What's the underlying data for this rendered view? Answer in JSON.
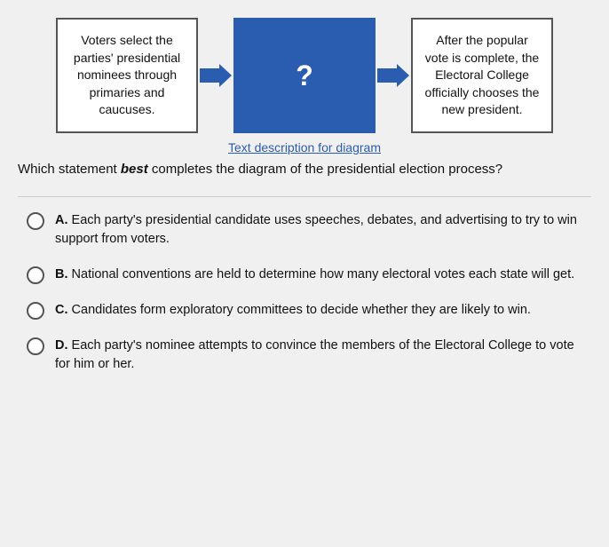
{
  "diagram": {
    "box1_text": "Voters select the parties' presidential nominees through primaries and caucuses.",
    "box2_text": "?",
    "box3_text": "After the popular vote is complete, the Electoral College officially chooses the new president.",
    "caption": "Text description for diagram"
  },
  "question": {
    "text_before": "Which statement ",
    "text_italic": "best",
    "text_after": " completes the diagram of the presidential election process?"
  },
  "options": [
    {
      "letter": "A.",
      "text": "Each party's presidential candidate uses speeches, debates, and advertising to try to win support from voters."
    },
    {
      "letter": "B.",
      "text": "National conventions are held to determine how many electoral votes each state will get."
    },
    {
      "letter": "C.",
      "text": "Candidates form exploratory committees to decide whether they are likely to win."
    },
    {
      "letter": "D.",
      "text": "Each party's nominee attempts to convince the members of the Electoral College to vote for him or her."
    }
  ]
}
